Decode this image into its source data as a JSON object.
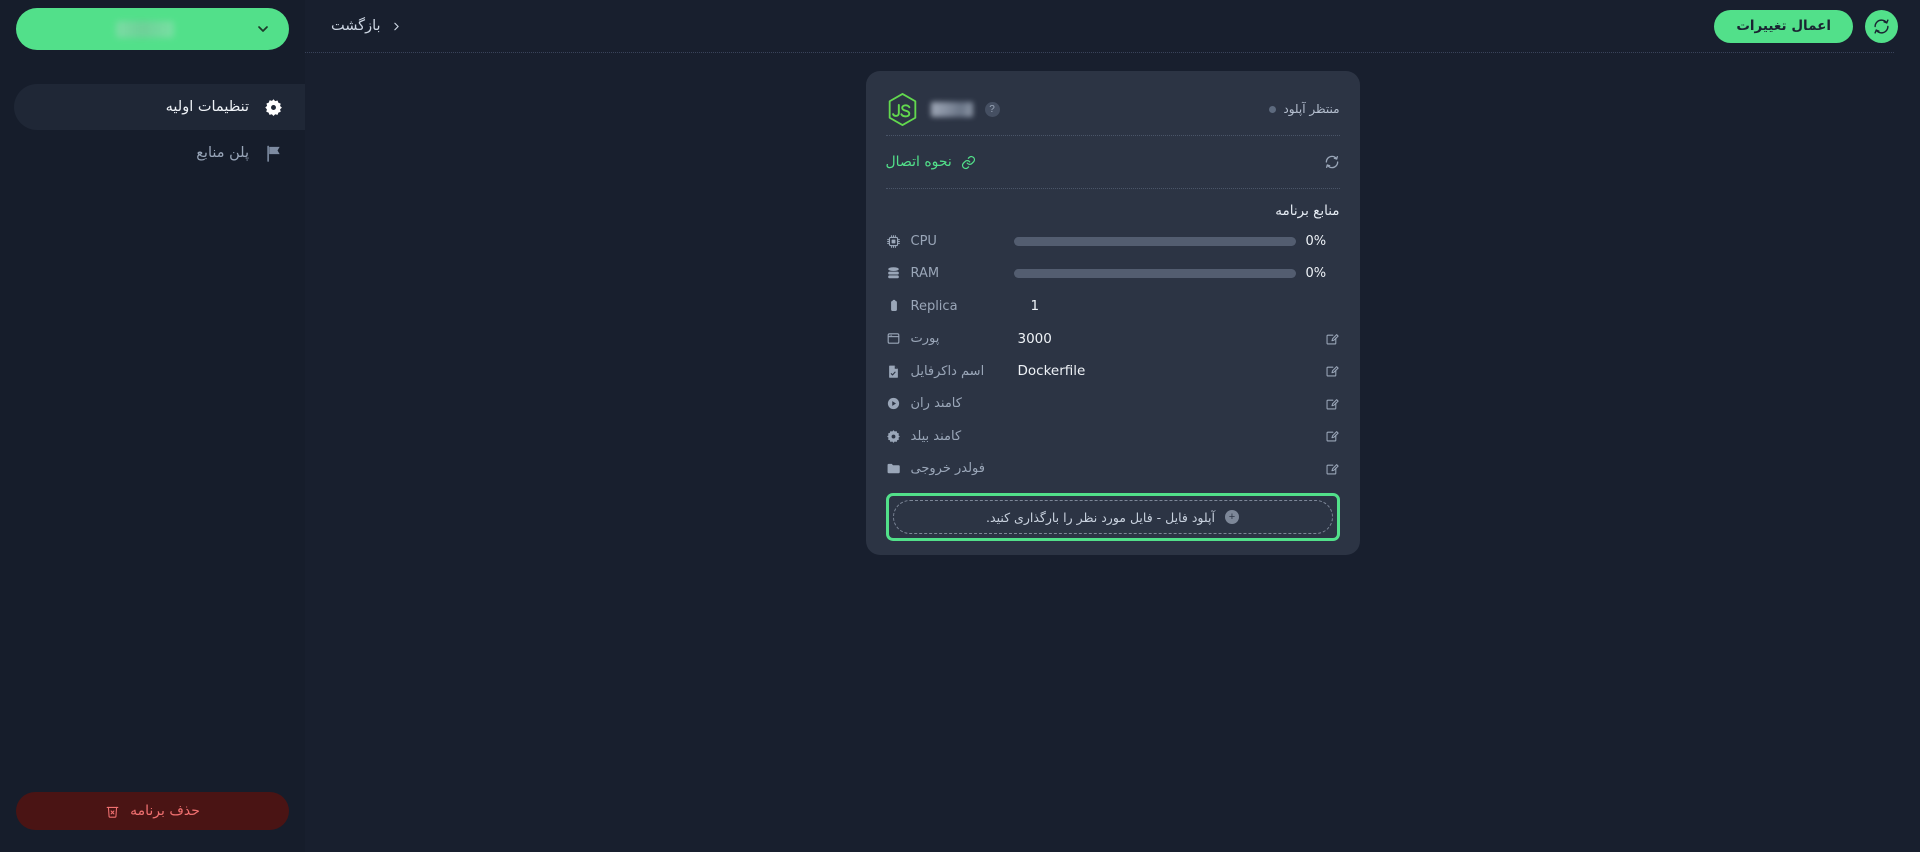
{
  "topbar": {
    "back_label": "بازگشت",
    "apply_label": "اعمال تغییرات",
    "refresh_icon": "refresh-icon",
    "back_chevron_icon": "chevron-left-icon"
  },
  "sidebar": {
    "app_selector": {
      "value": "",
      "chevron_icon": "chevron-down-icon",
      "redacted": true
    },
    "items": [
      {
        "label": "تنظیمات اولیه",
        "icon": "gear-icon",
        "active": true
      },
      {
        "label": "پلن منابع",
        "icon": "flag-icon",
        "active": false
      }
    ],
    "delete_button": {
      "label": "حذف برنامه",
      "icon": "trash-x-icon",
      "color": "#f07070",
      "background": "#4a1414"
    }
  },
  "card": {
    "runtime_icon": "nodejs-js-logo",
    "app_name": "",
    "app_name_redacted": true,
    "help_icon": "?",
    "status": "منتظر آپلود",
    "connection": {
      "label": "نحوه اتصال",
      "icon": "link-icon",
      "refresh_icon": "refresh-icon",
      "color": "#52e08a"
    },
    "resources_title": "منابع برنامه",
    "resources": [
      {
        "label": "CPU",
        "icon": "cpu-chip-icon",
        "value": "0%",
        "percent": 0,
        "has_bar": true
      },
      {
        "label": "RAM",
        "icon": "memory-stack-icon",
        "value": "0%",
        "percent": 0,
        "has_bar": true
      },
      {
        "label": "Replica",
        "icon": "clipboard-icon",
        "value": "1",
        "has_bar": false
      }
    ],
    "fields": [
      {
        "label": "پورت",
        "icon": "window-icon",
        "value": "3000",
        "edit_icon": "edit-pencil-icon"
      },
      {
        "label": "اسم داکرفایل",
        "icon": "file-check-icon",
        "value": "Dockerfile",
        "edit_icon": "edit-pencil-icon"
      },
      {
        "label": "کامند ران",
        "icon": "play-circle-icon",
        "value": "",
        "edit_icon": "edit-pencil-icon"
      },
      {
        "label": "کامند بیلد",
        "icon": "gear-icon",
        "value": "",
        "edit_icon": "edit-pencil-icon"
      },
      {
        "label": "فولدر خروجی",
        "icon": "folder-icon",
        "value": "",
        "edit_icon": "edit-pencil-icon"
      }
    ],
    "upload": {
      "label": "آپلود فایل - فایل مورد نظر را بارگذاری کنید.",
      "icon": "plus-circle-icon",
      "highlighted": true,
      "highlight_color": "#52e08a"
    }
  },
  "colors": {
    "accent_green": "#52e08a",
    "page_bg": "#181f2e",
    "sidebar_bg": "#161d2b",
    "card_bg": "#2c3444",
    "danger": "#f07070"
  }
}
